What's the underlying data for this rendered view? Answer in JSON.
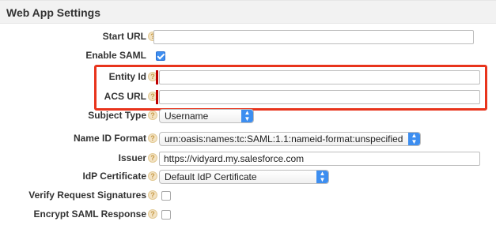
{
  "section": {
    "title": "Web App Settings"
  },
  "fields": {
    "start_url": {
      "label": "Start URL",
      "value": ""
    },
    "enable_saml": {
      "label": "Enable SAML",
      "checked": true
    },
    "entity_id": {
      "label": "Entity Id",
      "value": ""
    },
    "acs_url": {
      "label": "ACS URL",
      "value": ""
    },
    "subject_type": {
      "label": "Subject Type",
      "selected": "Username"
    },
    "name_id_format": {
      "label": "Name ID Format",
      "selected": "urn:oasis:names:tc:SAML:1.1:nameid-format:unspecified"
    },
    "issuer": {
      "label": "Issuer",
      "value": "https://vidyard.my.salesforce.com"
    },
    "idp_certificate": {
      "label": "IdP Certificate",
      "selected": "Default IdP Certificate"
    },
    "verify_request_signatures": {
      "label": "Verify Request Signatures",
      "checked": false
    },
    "encrypt_saml_response": {
      "label": "Encrypt SAML Response",
      "checked": false
    }
  },
  "icons": {
    "help": "help-icon",
    "select_arrows": "updown-arrows-icon"
  },
  "colors": {
    "highlight": "#e8341c",
    "required": "#c00000",
    "accent": "#3d8ef0"
  }
}
